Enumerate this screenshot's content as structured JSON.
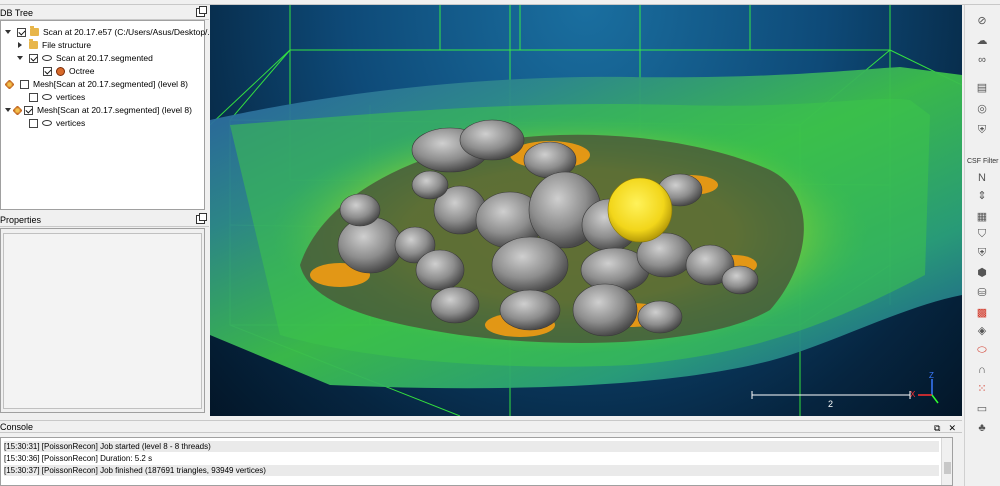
{
  "db_tree": {
    "title": "DB Tree",
    "items": [
      {
        "label": "Scan at 20.17.e57 (C:/Users/Asus/Desktop/..."
      },
      {
        "label": "File structure"
      },
      {
        "label": "Scan at 20.17.segmented"
      },
      {
        "label": "Octree"
      },
      {
        "label": "Mesh[Scan at 20.17.segmented] (level 8)"
      },
      {
        "label": "vertices"
      },
      {
        "label": "Mesh[Scan at 20.17.segmented] (level 8)"
      },
      {
        "label": "vertices"
      }
    ]
  },
  "properties": {
    "title": "Properties"
  },
  "view": {
    "scale_label": "2",
    "axis_z": "Z",
    "axis_x": "X",
    "colors": {
      "grid": "#3cff3c",
      "terrain_low": "#1d4f9a",
      "terrain_mid": "#2fbf5a",
      "terrain_high": "#e8e81a",
      "peak": "#f39c12",
      "rock": "#8a8a8a"
    }
  },
  "right_toolbar": {
    "csf_label": "CSF Filter",
    "icons": [
      "no-entry-icon",
      "cloud-icon",
      "binoculars-icon",
      "grid-icon",
      "clapper-icon",
      "compass-icon",
      "shield-icon",
      "filter-icon",
      "north-icon",
      "scale-icon",
      "m3c2-icon",
      "shield2-icon",
      "hexagon-icon",
      "db-icon",
      "layers-icon",
      "stack-icon",
      "ellipse-icon",
      "magnet-icon",
      "dotgrid-icon",
      "ruler-icon",
      "tree-icon"
    ]
  },
  "console": {
    "title": "Console",
    "lines": [
      "[15:30:31] [PoissonRecon] Job started (level 8 - 8 threads)",
      "[15:30:36] [PoissonRecon] Duration: 5.2 s",
      "[15:30:37] [PoissonRecon] Job finished (187691 triangles, 93949 vertices)"
    ]
  }
}
